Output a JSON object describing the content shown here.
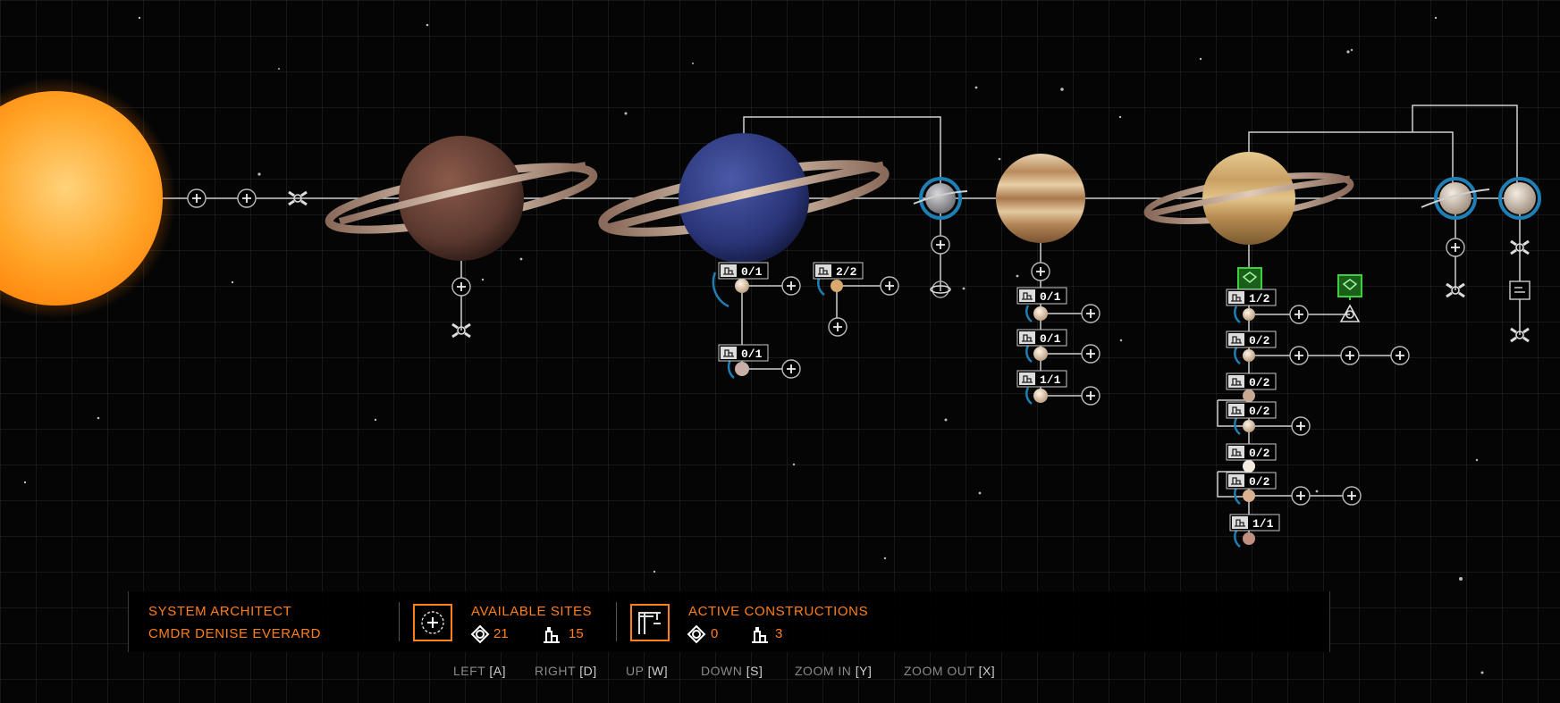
{
  "hud": {
    "title": "SYSTEM ARCHITECT",
    "commander": "CMDR DENISE EVERARD",
    "available_sites": {
      "label": "AVAILABLE SITES",
      "orbital_count": "21",
      "surface_count": "15"
    },
    "active_constructions": {
      "label": "ACTIVE CONSTRUCTIONS",
      "orbital_count": "0",
      "surface_count": "3"
    }
  },
  "controls": [
    {
      "label": "LEFT",
      "key": "[A]"
    },
    {
      "label": "RIGHT",
      "key": "[D]"
    },
    {
      "label": "UP",
      "key": "[W]"
    },
    {
      "label": "DOWN",
      "key": "[S]"
    },
    {
      "label": "ZOOM IN",
      "key": "[Y]"
    },
    {
      "label": "ZOOM OUT",
      "key": "[X]"
    }
  ],
  "site_badges": [
    "0/1",
    "2/2",
    "0/1",
    "0/1",
    "0/1",
    "1/1",
    "1/2",
    "0/2",
    "0/2",
    "0/2",
    "0/2",
    "0/2",
    "1/1"
  ],
  "colors": {
    "accent": "#ff7f1a",
    "line": "#cfcfcf",
    "ring": "#1e7fb5",
    "facility": "#3bd13b"
  }
}
